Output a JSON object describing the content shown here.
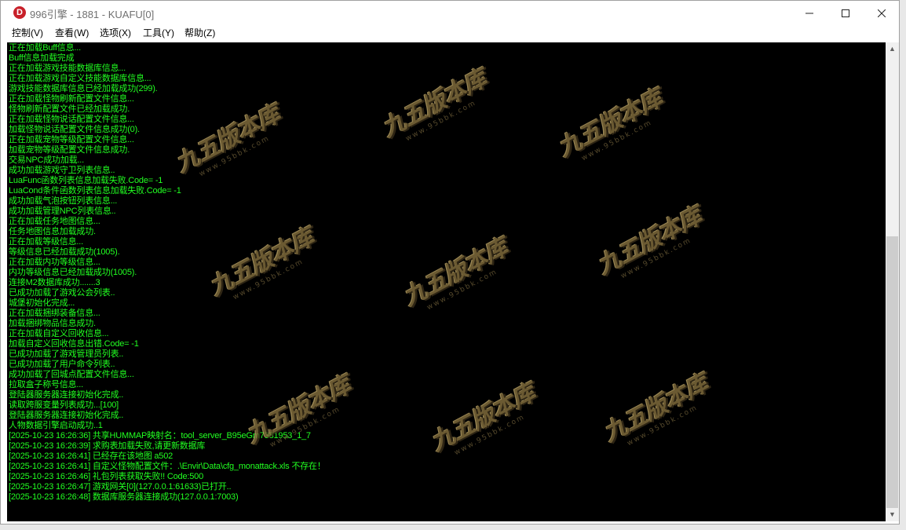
{
  "window": {
    "title": "996引擎 - 1881 - KUAFU[0]",
    "app_icon_letter": "D",
    "minimize_glyph": "—",
    "close_glyph": "✕"
  },
  "menu": {
    "items": [
      {
        "label": "控制(V)"
      },
      {
        "label": "查看(W)"
      },
      {
        "label": "选项(X)"
      },
      {
        "label": "工具(Y)"
      },
      {
        "label": "帮助(Z)"
      }
    ]
  },
  "console": {
    "text_color": "#21ff21",
    "background": "#000000",
    "lines": [
      "正在加载Buff信息...",
      "Buff信息加载完成",
      "正在加载游戏技能数据库信息...",
      "正在加载游戏自定义技能数据库信息...",
      "游戏技能数据库信息已经加载成功(299).",
      "正在加载怪物刷新配置文件信息...",
      "怪物刷新配置文件已经加载成功.",
      "正在加载怪物说话配置文件信息...",
      "加载怪物说话配置文件信息成功(0).",
      "正在加载宠物等级配置文件信息...",
      "加载宠物等级配置文件信息成功.",
      "交易NPC成功加载...",
      "成功加载游戏守卫列表信息..",
      "LuaFunc函数列表信息加载失败.Code= -1",
      "LuaCond条件函数列表信息加载失败.Code= -1",
      "成功加载气泡按钮列表信息...",
      "成功加载管理NPC列表信息..",
      "正在加载任务地图信息...",
      "任务地图信息加载成功.",
      "正在加载等级信息...",
      "等级信息已经加载成功(1005).",
      "正在加载内功等级信息...",
      "内功等级信息已经加载成功(1005).",
      "连接M2数据库成功.......3",
      "已成功加载了游戏公会列表..",
      "城堡初始化完成...",
      "正在加载捆绑装备信息...",
      "加载捆绑物品信息成功.",
      "正在加载自定义回收信息...",
      "加载自定义回收信息出错.Code= -1",
      "已成功加载了游戏管理员列表..",
      "已成功加载了用户命令列表..",
      "成功加载了回城点配置文件信息...",
      "拉取盒子称号信息...",
      "登陆器服务器连接初始化完成..",
      "读取跨服变量列表成功...[100]",
      "登陆器服务器连接初始化完成..",
      "人物数据引擎启动成功..1",
      "[2025-10-23 16:26:36] 共享HUMMAP映射名：tool_server_B95eGm7381953_1_7",
      "[2025-10-23 16:26:39] 求购表加载失败,请更新数据库",
      "[2025-10-23 16:26:41] 已经存在该地图 a502",
      "[2025-10-23 16:26:41] 自定义怪物配置文件：.\\Envir\\Data\\cfg_monattack.xls 不存在！",
      "[2025-10-23 16:26:46] 礼包列表获取失败!! Code:500",
      "[2025-10-23 16:26:47] 游戏网关[0](127.0.0.1:61633)已打开..",
      "[2025-10-23 16:26:48] 数据库服务器连接成功(127.0.0.1:7003)"
    ]
  },
  "watermark": {
    "logo_text": "九五版本库",
    "url_text": "www.95bbk.com"
  },
  "scrollbar": {
    "up_glyph": "▲",
    "down_glyph": "▼",
    "position_fraction": 0.4,
    "visible_fraction": 0.6
  }
}
